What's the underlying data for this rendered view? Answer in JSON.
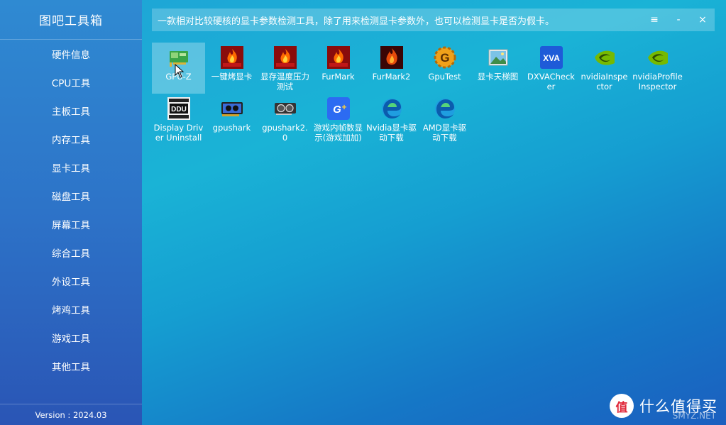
{
  "sidebar": {
    "title": "图吧工具箱",
    "items": [
      {
        "label": "硬件信息"
      },
      {
        "label": "CPU工具"
      },
      {
        "label": "主板工具"
      },
      {
        "label": "内存工具"
      },
      {
        "label": "显卡工具"
      },
      {
        "label": "磁盘工具"
      },
      {
        "label": "屏幕工具"
      },
      {
        "label": "综合工具"
      },
      {
        "label": "外设工具"
      },
      {
        "label": "烤鸡工具"
      },
      {
        "label": "游戏工具"
      },
      {
        "label": "其他工具"
      }
    ],
    "version": "Version : 2024.03"
  },
  "header": {
    "description": "一款相对比较硬核的显卡参数检测工具，除了用来检测显卡参数外，也可以检测显卡是否为假卡。",
    "menu_icon": "≡",
    "minimize_icon": "-",
    "close_icon": "×"
  },
  "tools": [
    {
      "label": "GPU-Z",
      "icon": "gpuz-icon"
    },
    {
      "label": "一键烤显卡",
      "icon": "furmark-icon"
    },
    {
      "label": "显存温度压力测试",
      "icon": "furmark-icon"
    },
    {
      "label": "FurMark",
      "icon": "furmark-icon"
    },
    {
      "label": "FurMark2",
      "icon": "furmark2-icon"
    },
    {
      "label": "GpuTest",
      "icon": "gputest-icon"
    },
    {
      "label": "显卡天梯图",
      "icon": "picture-icon"
    },
    {
      "label": "DXVAChecker",
      "icon": "xva-icon"
    },
    {
      "label": "nvidiaInspector",
      "icon": "nvidia-icon"
    },
    {
      "label": "nvidiaProfileInspector",
      "icon": "nvidia-icon"
    },
    {
      "label": "Display Driver Uninstall",
      "icon": "ddu-icon"
    },
    {
      "label": "gpushark",
      "icon": "gpushark-icon"
    },
    {
      "label": "gpushark2.0",
      "icon": "gpushark2-icon"
    },
    {
      "label": "游戏内帧数显示(游戏加加)",
      "icon": "gplus-icon"
    },
    {
      "label": "Nvidia显卡驱动下载",
      "icon": "edge-icon"
    },
    {
      "label": "AMD显卡驱动下载",
      "icon": "edge-icon"
    }
  ],
  "watermark": {
    "logo": "值",
    "text": "什么值得买",
    "small": "SMYZ.NET"
  },
  "colors": {
    "accent": "#1aa6d8",
    "sidebar": "#2d73c8"
  }
}
